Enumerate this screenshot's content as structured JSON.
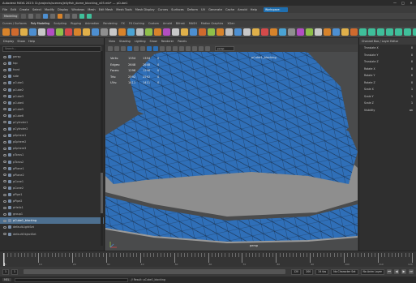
{
  "window": {
    "title": "Autodesk MAYA 2023: D:/projects/scenes/jellyfish_dome_blocking_v05.mb* --- pCube1"
  },
  "window_controls": [
    "—",
    "□",
    "✕"
  ],
  "menubar": {
    "items": [
      "File",
      "Edit",
      "Create",
      "Select",
      "Modify",
      "Display",
      "Windows",
      "Mesh",
      "Edit Mesh",
      "Mesh Tools",
      "Mesh Display",
      "Curves",
      "Surfaces",
      "Deform",
      "UV",
      "Generate",
      "Cache",
      "Arnold",
      "Help"
    ],
    "workspace_label": "Workspace: General"
  },
  "statusline": {
    "mode": "Modeling"
  },
  "shelf": {
    "tabs": [
      "Curves / Surfaces",
      "Poly Modeling",
      "Sculpting",
      "Rigging",
      "Animation",
      "Rendering",
      "FX",
      "FX Caching",
      "Custom",
      "Arnold",
      "Bifrost",
      "MASH",
      "Motion Graphics",
      "XGen"
    ],
    "active_tab": 1,
    "tool_colors": [
      "#d7832b",
      "#cf6a2e",
      "#e0b04a",
      "#4d8fd1",
      "#c8c8c8",
      "#b24ec2",
      "#8fbf4a",
      "#d54a4a",
      "#d7832b",
      "#e0b04a",
      "#4d8fd1",
      "#8f8f8f",
      "#c8c8c8",
      "#d7832b",
      "#4aa3d4",
      "#bfbfbf",
      "#8fbf4a",
      "#d7832b",
      "#b24ec2",
      "#c8c8c8",
      "#e0b04a",
      "#4d8fd1",
      "#cf6a2e",
      "#8fbf4a",
      "#d7832b",
      "#bfbfbf",
      "#4d8fd1",
      "#c8c8c8",
      "#e0b04a",
      "#d54a4a",
      "#d7832b",
      "#4aa3d4",
      "#8f8f8f",
      "#b24ec2",
      "#8fbf4a",
      "#c8c8c8",
      "#d7832b",
      "#4d8fd1",
      "#e0b04a",
      "#cf6a2e",
      "#3fbf9a",
      "#3fbf9a",
      "#3fbf9a",
      "#3fbf9a",
      "#3fbf9a",
      "#3fbf9a",
      "#3fbf9a",
      "#3fbf9a"
    ]
  },
  "outliner": {
    "tabs": [
      "Display",
      "Show",
      "Help"
    ],
    "search_placeholder": "Search...",
    "selected_index": 25,
    "rows": [
      "persp",
      "top",
      "front",
      "side",
      "pCube1",
      "pCube2",
      "pCube3",
      "pCube4",
      "pCube5",
      "pCube6",
      "pCylinder1",
      "pCylinder2",
      "pSphere1",
      "pSphere2",
      "pSphere3",
      "pTorus1",
      "pTorus2",
      "pPlane1",
      "pPlane2",
      "pCone1",
      "pCone2",
      "pPipe1",
      "pPipe2",
      "pHelix1",
      "group1",
      "pCube1_blocking",
      "defaultLightSet",
      "defaultObjectSet"
    ]
  },
  "viewport": {
    "menu": [
      "View",
      "Shading",
      "Lighting",
      "Show",
      "Renderer",
      "Panels"
    ],
    "camera_field": "persp",
    "hud": {
      "rows": [
        [
          "Verts:",
          "1354",
          "1354",
          "0"
        ],
        [
          "Edges:",
          "2648",
          "2648",
          "0"
        ],
        [
          "Faces:",
          "1296",
          "1296",
          "0"
        ],
        [
          "Tris:",
          "2592",
          "2592",
          "0"
        ],
        [
          "UVs:",
          "1411",
          "1411",
          "0"
        ]
      ]
    },
    "mesh_label": "pCube1_blocking",
    "camera_label": "persp",
    "mesh_color": "#2f6fb8"
  },
  "attributes": {
    "header": "Channel Box / Layer Editor",
    "rows": [
      [
        "Translate X",
        "0"
      ],
      [
        "Translate Y",
        "0"
      ],
      [
        "Translate Z",
        "0"
      ],
      [
        "Rotate X",
        "0"
      ],
      [
        "Rotate Y",
        "0"
      ],
      [
        "Rotate Z",
        "0"
      ],
      [
        "Scale X",
        "1"
      ],
      [
        "Scale Y",
        "1"
      ],
      [
        "Scale Z",
        "1"
      ],
      [
        "Visibility",
        "on"
      ]
    ]
  },
  "timeline": {
    "labels": [
      "1",
      "10",
      "20",
      "30",
      "40",
      "50",
      "60",
      "70",
      "80",
      "90",
      "100",
      "110",
      "120"
    ]
  },
  "rangebar": {
    "start": "1",
    "min": "1",
    "max": "120",
    "end": "200",
    "fps": "24 fps",
    "character_set": "No Character Set",
    "anim_layer": "No Anim Layer",
    "playback": [
      "⏮",
      "◀",
      "▶",
      "⏭"
    ]
  },
  "cmdline": {
    "lang": "MEL",
    "result": "// Result: pCube1_blocking"
  }
}
